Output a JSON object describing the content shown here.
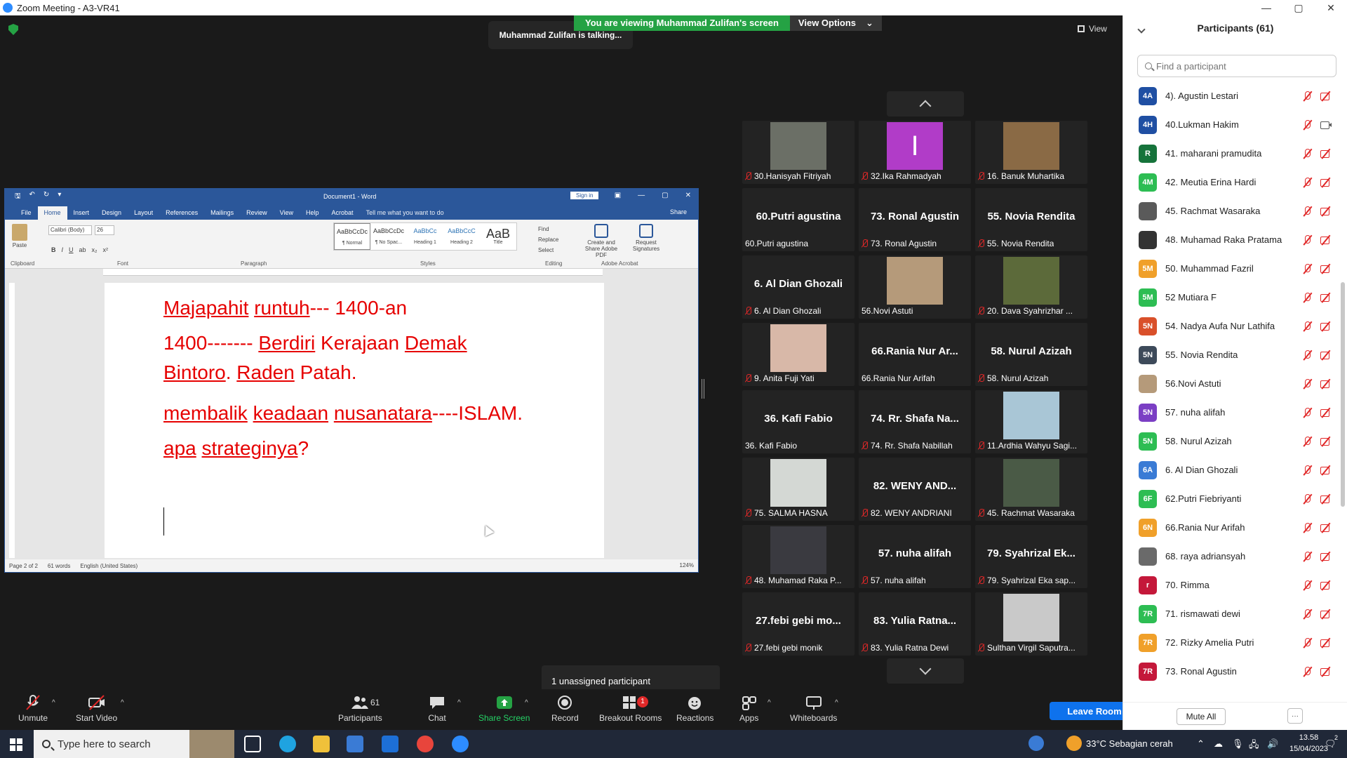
{
  "window": {
    "title": "Zoom Meeting - A3-VR41",
    "controls": [
      "—",
      "▢",
      "✕"
    ]
  },
  "share_banner": {
    "viewing": "You are viewing Muhammad Zulifan's screen",
    "view_options": "View Options",
    "caret": "⌄"
  },
  "talking": "Muhammad Zulifan is talking...",
  "view_label": "View",
  "word": {
    "quick_access": [
      "🖫",
      "↶",
      "↻",
      "▾"
    ],
    "title": "Document1 - Word",
    "sign_in": "Sign in",
    "window_controls": [
      "▣",
      "—",
      "▢",
      "✕"
    ],
    "tabs": [
      "File",
      "Home",
      "Insert",
      "Design",
      "Layout",
      "References",
      "Mailings",
      "Review",
      "View",
      "Help",
      "Acrobat"
    ],
    "tell_me": "Tell me what you want to do",
    "share": "Share",
    "paste": "Paste",
    "font_name": "Calibri (Body)",
    "font_size": "26",
    "format_buttons": [
      "B",
      "I",
      "U",
      "ab",
      "x₂",
      "x²"
    ],
    "groups": {
      "clipboard": "Clipboard",
      "font": "Font",
      "paragraph": "Paragraph",
      "styles": "Styles",
      "editing": "Editing",
      "adobe": "Adobe Acrobat"
    },
    "styles": [
      {
        "sample": "AaBbCcDc",
        "name": "¶ Normal"
      },
      {
        "sample": "AaBbCcDc",
        "name": "¶ No Spac..."
      },
      {
        "sample": "AaBbCc",
        "name": "Heading 1"
      },
      {
        "sample": "AaBbCcC",
        "name": "Heading 2"
      },
      {
        "sample": "AaB",
        "name": "Title"
      }
    ],
    "editing": [
      "Find",
      "Replace",
      "Select"
    ],
    "acrobat": [
      "Create and Share Adobe PDF",
      "Request Signatures"
    ],
    "doc_lines": [
      {
        "parts": [
          {
            "t": "Majapahit",
            "u": true
          },
          {
            "t": " ",
            "u": false
          },
          {
            "t": "runtuh",
            "u": true
          },
          {
            "t": "--- 1400-an",
            "u": false
          }
        ]
      },
      {
        "parts": [
          {
            "t": "1400------- ",
            "u": false
          },
          {
            "t": "Berdiri",
            "u": true
          },
          {
            "t": " Kerajaan ",
            "u": false
          },
          {
            "t": "Demak",
            "u": true
          }
        ]
      },
      {
        "parts": [
          {
            "t": "Bintoro",
            "u": true
          },
          {
            "t": ". ",
            "u": false
          },
          {
            "t": "Raden",
            "u": true
          },
          {
            "t": " Patah.",
            "u": false
          }
        ]
      },
      {
        "parts": [
          {
            "t": "membalik",
            "u": true
          },
          {
            "t": " ",
            "u": false
          },
          {
            "t": "keadaan",
            "u": true
          },
          {
            "t": " ",
            "u": false
          },
          {
            "t": "nusanatara",
            "u": true
          },
          {
            "t": "----ISLAM.",
            "u": false
          }
        ]
      },
      {
        "parts": [
          {
            "t": "apa",
            "u": true
          },
          {
            "t": " ",
            "u": false
          },
          {
            "t": "strateginya",
            "u": true
          },
          {
            "t": "?",
            "u": false
          }
        ]
      }
    ],
    "status": {
      "page": "Page 2 of 2",
      "words": "61 words",
      "language": "English (United States)",
      "zoom": "124%"
    }
  },
  "gallery": [
    {
      "label": "30.Hanisyah Fitriyah",
      "big": "",
      "photo": "#6b6f66",
      "muted": true
    },
    {
      "label": "32.Ika Rahmadyah",
      "big": "",
      "photo": "#b13cc8",
      "letter": "I",
      "muted": true
    },
    {
      "label": "16. Banuk Muhartika",
      "big": "",
      "photo": "#8a6a45",
      "muted": true
    },
    {
      "label": "60.Putri agustina",
      "big": "60.Putri agustina",
      "muted": false
    },
    {
      "label": "73. Ronal Agustin",
      "big": "73. Ronal Agustin",
      "muted": true
    },
    {
      "label": "55. Novia Rendita",
      "big": "55. Novia Rendita",
      "muted": true
    },
    {
      "label": "6. Al Dian Ghozali",
      "big": "6. Al Dian Ghozali",
      "muted": true
    },
    {
      "label": "56.Novi Astuti",
      "big": "",
      "photo": "#b59a7a",
      "muted": false
    },
    {
      "label": "20. Dava Syahrizhar ...",
      "big": "",
      "photo": "#5c6a3a",
      "muted": true
    },
    {
      "label": "9. Anita Fuji Yati",
      "big": "",
      "photo": "#d8b8a8",
      "muted": true
    },
    {
      "label": "66.Rania Nur Arifah",
      "big": "66.Rania Nur Ar...",
      "muted": false
    },
    {
      "label": "58. Nurul Azizah",
      "big": "58. Nurul Azizah",
      "muted": true
    },
    {
      "label": "36. Kafi Fabio",
      "big": "36. Kafi Fabio",
      "muted": false
    },
    {
      "label": "74. Rr. Shafa Nabillah",
      "big": "74. Rr. Shafa Na...",
      "muted": true
    },
    {
      "label": "11.Ardhia Wahyu Sagi...",
      "big": "",
      "photo": "#a9c6d6",
      "muted": true
    },
    {
      "label": "75. SALMA HASNA",
      "big": "",
      "photo": "#d4d8d4",
      "muted": true
    },
    {
      "label": "82. WENY ANDRIANI",
      "big": "82. WENY AND...",
      "muted": true
    },
    {
      "label": "45. Rachmat Wasaraka",
      "big": "",
      "photo": "#4a5a46",
      "muted": true
    },
    {
      "label": "48. Muhamad Raka P...",
      "big": "",
      "photo": "#3a3a40",
      "muted": true
    },
    {
      "label": "57. nuha alifah",
      "big": "57. nuha alifah",
      "muted": true
    },
    {
      "label": "79. Syahrizal Eka sap...",
      "big": "79. Syahrizal Ek...",
      "muted": true
    },
    {
      "label": "27.febi gebi monik",
      "big": "27.febi gebi mo...",
      "muted": true
    },
    {
      "label": "83. Yulia Ratna Dewi",
      "big": "83. Yulia Ratna...",
      "muted": true
    },
    {
      "label": "Sulthan Virgil Saputra...",
      "big": "",
      "photo": "#c9c9c9",
      "muted": true
    }
  ],
  "unassigned": "1 unassigned participant",
  "toolbar": {
    "unmute": "Unmute",
    "start_video": "Start Video",
    "participants": "Participants",
    "participants_count": "61",
    "chat": "Chat",
    "share_screen": "Share Screen",
    "record": "Record",
    "breakout": "Breakout Rooms",
    "breakout_badge": "1",
    "reactions": "Reactions",
    "apps": "Apps",
    "whiteboards": "Whiteboards",
    "leave": "Leave Room",
    "caret": "^"
  },
  "panel": {
    "title": "Participants (61)",
    "search_placeholder": "Find a participant",
    "mute_all": "Mute All",
    "more": "···",
    "participants": [
      {
        "initials": "4A",
        "color": "#1f4fa3",
        "name": "4). Agustin Lestari",
        "cam": "off"
      },
      {
        "initials": "4H",
        "color": "#1f4fa3",
        "name": "40.Lukman Hakim",
        "cam": "on"
      },
      {
        "initials": "R",
        "color": "#16733b",
        "name": "41. maharani pramudita",
        "cam": "off"
      },
      {
        "initials": "4M",
        "color": "#2dbd53",
        "name": "42. Meutia Erina Hardi",
        "cam": "off"
      },
      {
        "initials": "",
        "color": "#5a5a5a",
        "name": "45. Rachmat Wasaraka",
        "cam": "off"
      },
      {
        "initials": "",
        "color": "#333333",
        "name": "48. Muhamad Raka Pratama",
        "cam": "off"
      },
      {
        "initials": "5M",
        "color": "#f0a02a",
        "name": "50. Muhammad Fazril",
        "cam": "off"
      },
      {
        "initials": "5M",
        "color": "#2dbd53",
        "name": "52 Mutiara F",
        "cam": "off"
      },
      {
        "initials": "5N",
        "color": "#d9502a",
        "name": "54. Nadya Aufa Nur Lathifa",
        "cam": "off"
      },
      {
        "initials": "5N",
        "color": "#3d4a5a",
        "name": "55. Novia Rendita",
        "cam": "off"
      },
      {
        "initials": "",
        "color": "#b59a7a",
        "name": "56.Novi Astuti",
        "cam": "off"
      },
      {
        "initials": "5N",
        "color": "#7b3fc4",
        "name": "57. nuha alifah",
        "cam": "off"
      },
      {
        "initials": "5N",
        "color": "#2dbd53",
        "name": "58. Nurul Azizah",
        "cam": "off"
      },
      {
        "initials": "6A",
        "color": "#3a7bd5",
        "name": "6. Al Dian Ghozali",
        "cam": "off"
      },
      {
        "initials": "6F",
        "color": "#2dbd53",
        "name": "62.Putri Fiebriyanti",
        "cam": "off"
      },
      {
        "initials": "6N",
        "color": "#f0a02a",
        "name": "66.Rania Nur Arifah",
        "cam": "off"
      },
      {
        "initials": "",
        "color": "#6a6a6a",
        "name": "68. raya adriansyah",
        "cam": "off"
      },
      {
        "initials": "r",
        "color": "#c4183a",
        "name": "70. Rimma",
        "cam": "off"
      },
      {
        "initials": "7R",
        "color": "#2dbd53",
        "name": "71. rismawati dewi",
        "cam": "off"
      },
      {
        "initials": "7R",
        "color": "#f0a02a",
        "name": "72. Rizky Amelia Putri",
        "cam": "off"
      },
      {
        "initials": "7R",
        "color": "#c4183a",
        "name": "73. Ronal Agustin",
        "cam": "off"
      }
    ]
  },
  "taskbar": {
    "search": "Type here to search",
    "weather": "33°C  Sebagian cerah",
    "time": "13.58",
    "date": "15/04/2023",
    "notification_count": "2"
  }
}
